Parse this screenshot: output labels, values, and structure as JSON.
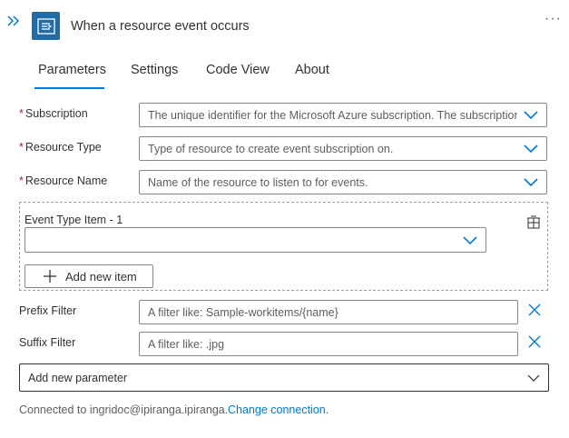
{
  "header": {
    "title": "When a resource event occurs",
    "collapse_icon": "double-chevron-right-icon",
    "connector_icon": "event-grid-icon",
    "more_label": "···"
  },
  "tabs": [
    {
      "label": "Parameters",
      "active": true
    },
    {
      "label": "Settings",
      "active": false
    },
    {
      "label": "Code View",
      "active": false
    },
    {
      "label": "About",
      "active": false
    }
  ],
  "fields": {
    "subscription": {
      "label": "Subscription",
      "required_mark": "*",
      "placeholder": "The unique identifier for the Microsoft Azure subscription. The subscription ID"
    },
    "resource_type": {
      "label": "Resource Type",
      "required_mark": "*",
      "placeholder": "Type of resource to create event subscription on."
    },
    "resource_name": {
      "label": "Resource Name",
      "required_mark": "*",
      "placeholder": "Name of the resource to listen to for events."
    }
  },
  "event_type_array": {
    "item_label": "Event Type Item - 1",
    "item_value": "",
    "add_button_label": "Add new item"
  },
  "filters": {
    "prefix": {
      "label": "Prefix Filter",
      "placeholder": "A filter like: Sample-workitems/{name}"
    },
    "suffix": {
      "label": "Suffix Filter",
      "placeholder": "A filter like: .jpg"
    }
  },
  "add_parameter": {
    "label": "Add new parameter"
  },
  "footer": {
    "connection_text": "Connected to ingridoc@ipiranga.ipiranga.",
    "change_link": "Change connection."
  },
  "colors": {
    "accent": "#0078d4",
    "required": "#a4262c",
    "connector_bg": "#1f6ca8"
  }
}
